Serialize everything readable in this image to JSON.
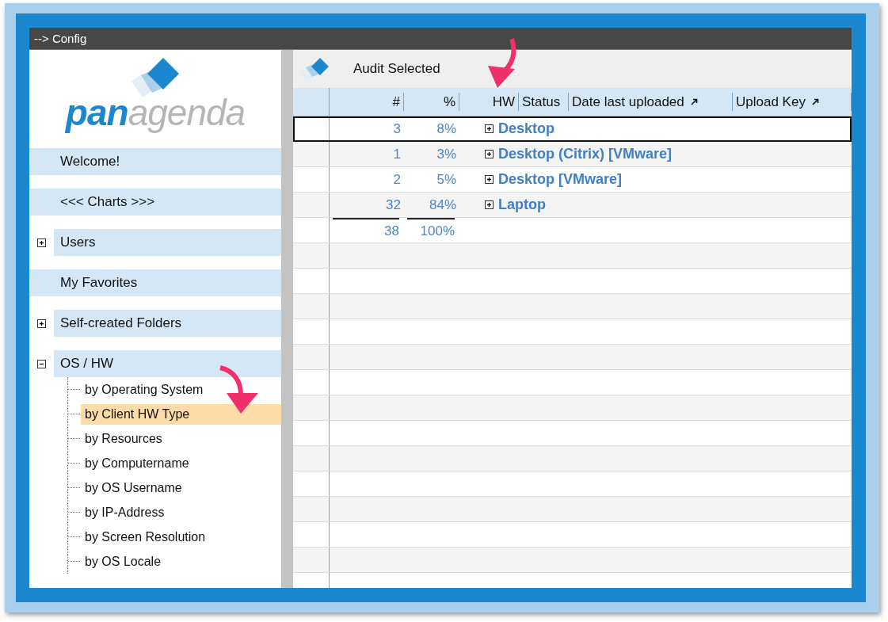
{
  "window": {
    "title": "--> Config"
  },
  "logo": {
    "parts": [
      "pan",
      "agenda"
    ]
  },
  "sidebar": {
    "items": [
      {
        "kind": "link",
        "label": "Welcome!",
        "selected": false
      },
      {
        "kind": "link",
        "label": "<<< Charts >>>",
        "selected": false
      },
      {
        "kind": "folder",
        "label": "Users",
        "expanded": false
      },
      {
        "kind": "link",
        "label": "My Favorites",
        "selected": false
      },
      {
        "kind": "folder",
        "label": "Self-created Folders",
        "expanded": false
      },
      {
        "kind": "folder",
        "label": "OS / HW",
        "expanded": true,
        "children": [
          {
            "label": "by Operating System",
            "selected": false
          },
          {
            "label": "by Client HW Type",
            "selected": true
          },
          {
            "label": "by Resources",
            "selected": false
          },
          {
            "label": "by Computername",
            "selected": false
          },
          {
            "label": "by OS Username",
            "selected": false
          },
          {
            "label": "by IP-Address",
            "selected": false
          },
          {
            "label": "by Screen Resolution",
            "selected": false
          },
          {
            "label": "by OS Locale",
            "selected": false
          }
        ]
      }
    ]
  },
  "toolbar": {
    "action": "Audit Selected"
  },
  "table": {
    "columns": [
      "#",
      "%",
      "HW",
      "Status",
      "Date last uploaded",
      "Upload Key"
    ],
    "rows": [
      {
        "count": "3",
        "percent": "8%",
        "hw": "Desktop",
        "expanded": false,
        "selected": true
      },
      {
        "count": "1",
        "percent": "3%",
        "hw": "Desktop (Citrix) [VMware]",
        "expanded": false,
        "selected": false
      },
      {
        "count": "2",
        "percent": "5%",
        "hw": "Desktop [VMware]",
        "expanded": false,
        "selected": false
      },
      {
        "count": "32",
        "percent": "84%",
        "hw": "Laptop",
        "expanded": false,
        "selected": false
      }
    ],
    "total": {
      "count": "38",
      "percent": "100%"
    }
  }
}
